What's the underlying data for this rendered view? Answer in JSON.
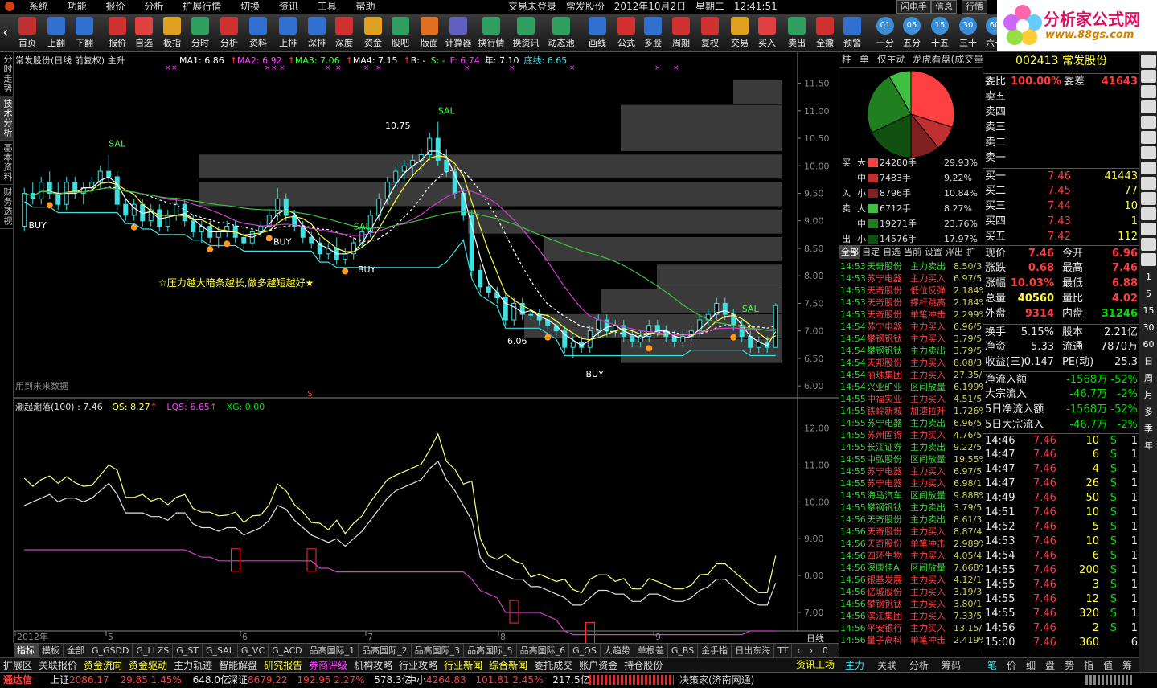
{
  "menu": [
    "系统",
    "功能",
    "报价",
    "分析",
    "扩展行情",
    "切换",
    "资讯",
    "工具",
    "帮助"
  ],
  "title": {
    "login": "交易未登录",
    "stock": "常发股份",
    "date": "2012年10月2日",
    "weekday": "星期二",
    "time": "12:41:51"
  },
  "top_buttons": [
    "闪电手",
    "信息",
    "行情"
  ],
  "toolbar": [
    "首页",
    "上翻",
    "下翻",
    "报价",
    "自选",
    "板指",
    "分时",
    "分析",
    "资料",
    "上排",
    "深排",
    "深度",
    "资金",
    "股吧",
    "版面",
    "计算器",
    "换行情",
    "换资讯",
    "动态池",
    "画线",
    "公式",
    "多股",
    "周期",
    "复权",
    "交易",
    "买入",
    "卖出",
    "全撤",
    "预警",
    "一分",
    "五分",
    "十五",
    "三十",
    "六十"
  ],
  "logo": {
    "text": "分析家公式网",
    "url": "www.88gs.com"
  },
  "left_tabs": [
    "分时走势",
    "技术分析",
    "基本资料",
    "财务透视"
  ],
  "chart": {
    "header": "常发股份(日线 前复权) 主升",
    "ma": [
      {
        "label": "MA1: 6.86",
        "color": "#ffffff"
      },
      {
        "label": "MA2: 6.92",
        "color": "#ff40ff"
      },
      {
        "label": "MA3: 7.06",
        "color": "#40ff40"
      },
      {
        "label": "MA4: 7.15",
        "color": "#ffffff"
      },
      {
        "label": "B: -",
        "color": "#ffffff"
      },
      {
        "label": "S: -",
        "color": "#40ff40"
      },
      {
        "label": "F: 6.74",
        "color": "#ff40ff"
      },
      {
        "label": "年: 7.10",
        "color": "#ffffff"
      },
      {
        "label": "底线: 6.65",
        "color": "#40e0e0"
      }
    ],
    "price_axis": [
      "11.50",
      "11.00",
      "10.50",
      "10.00",
      "9.50",
      "9.00",
      "8.50",
      "8.00",
      "7.50",
      "7.00",
      "6.50",
      "6.00"
    ],
    "slogan": "☆压力越大暗条越长,做多越短越好★",
    "future_label": "用到未来数据",
    "peak_label": "10.75",
    "low_label": "6.06",
    "sub_header": "潮起潮落(100) : 7.46",
    "qs": "QS: 8.27",
    "lqs": "LQS: 6.65",
    "xg": "XG: 0.00",
    "sub_axis": [
      "12.00",
      "11.00",
      "10.00",
      "9.00",
      "8.00",
      "7.00"
    ],
    "date_labels": [
      "2012年",
      "5",
      "6",
      "7",
      "8",
      "9"
    ],
    "period": "日线"
  },
  "signals": {
    "sal": "SAL",
    "buy": "BUY"
  },
  "mid": {
    "tabs": [
      "柱",
      "单",
      "仅主动",
      "龙虎看盘(成交量排名)"
    ],
    "flows": [
      {
        "side": "买",
        "size": "大",
        "value": "24280手",
        "pct": "29.93%",
        "color": "#ff4040"
      },
      {
        "side": "",
        "size": "中",
        "value": "7483手",
        "pct": "9.22%",
        "color": "#c03030"
      },
      {
        "side": "入",
        "size": "小",
        "value": "8796手",
        "pct": "10.84%",
        "color": "#802020"
      },
      {
        "side": "卖",
        "size": "大",
        "value": "6712手",
        "pct": "8.27%",
        "color": "#40c040"
      },
      {
        "side": "",
        "size": "中",
        "value": "19271手",
        "pct": "23.76%",
        "color": "#208020"
      },
      {
        "side": "出",
        "size": "小",
        "value": "14576手",
        "pct": "17.97%",
        "color": "#105010"
      }
    ],
    "filter_tabs": [
      "全部",
      "自定",
      "自选",
      "当前",
      "设置",
      "浮出",
      "扩"
    ],
    "radar": [
      [
        "14:53",
        "天奇股份",
        "主力卖出",
        "8.50/3"
      ],
      [
        "14:53",
        "苏宁电器",
        "主力买入",
        "6.97/5"
      ],
      [
        "14:53",
        "天奇股份",
        "低位反弹",
        "2.184%"
      ],
      [
        "14:53",
        "天奇股份",
        "撑杆跳高",
        "2.184%"
      ],
      [
        "14:53",
        "天奇股份",
        "单笔冲击",
        "2.299%"
      ],
      [
        "14:54",
        "苏宁电器",
        "主力买入",
        "6.96/5"
      ],
      [
        "14:54",
        "攀钢钒钛",
        "主力买入",
        "3.79/5"
      ],
      [
        "14:54",
        "攀钢钒钛",
        "主力卖出",
        "3.79/5"
      ],
      [
        "14:54",
        "天邦股份",
        "主力买入",
        "8.08/3"
      ],
      [
        "14:54",
        "丽珠集团",
        "主力买入",
        "27.35/"
      ],
      [
        "14:54",
        "兴业矿业",
        "区间放量",
        "6.199%"
      ],
      [
        "14:55",
        "中福实业",
        "主力买入",
        "4.51/5"
      ],
      [
        "14:55",
        "铁岭新城",
        "加速拉升",
        "1.726%"
      ],
      [
        "14:55",
        "苏宁电器",
        "主力卖出",
        "6.96/5"
      ],
      [
        "14:55",
        "苏州固锝",
        "主力买入",
        "4.76/5"
      ],
      [
        "14:55",
        "长江证券",
        "主力卖出",
        "9.22/5"
      ],
      [
        "14:55",
        "中弘股份",
        "区间放量",
        "19.55%"
      ],
      [
        "14:55",
        "苏宁电器",
        "主力买入",
        "6.97/5"
      ],
      [
        "14:55",
        "苏宁电器",
        "主力买入",
        "6.98/1"
      ],
      [
        "14:55",
        "海马汽车",
        "区间放量",
        "9.888%"
      ],
      [
        "14:55",
        "攀钢钒钛",
        "主力卖出",
        "3.79/5"
      ],
      [
        "14:56",
        "天奇股份",
        "主力卖出",
        "8.61/3"
      ],
      [
        "14:56",
        "天奇股份",
        "主力买入",
        "8.87/4"
      ],
      [
        "14:56",
        "天奇股份",
        "单笔冲击",
        "2.989%"
      ],
      [
        "14:56",
        "四环生物",
        "主力买入",
        "4.05/4"
      ],
      [
        "14:56",
        "深康佳A",
        "区间放量",
        "7.668%"
      ],
      [
        "14:56",
        "银基发展",
        "主力买入",
        "4.12/1"
      ],
      [
        "14:56",
        "亿城股份",
        "主力买入",
        "3.19/3"
      ],
      [
        "14:56",
        "攀钢钒钛",
        "主力买入",
        "3.80/1"
      ],
      [
        "14:56",
        "滨江集团",
        "主力买入",
        "7.33/5"
      ],
      [
        "14:56",
        "平安银行",
        "主力买入",
        "13.15/"
      ],
      [
        "14:56",
        "量子高科",
        "单笔冲击",
        "2.419%"
      ]
    ]
  },
  "quote": {
    "code": "002413",
    "name": "常发股份",
    "wb_label": "委比",
    "wb": "100.00%",
    "wc_label": "委差",
    "wc": "41643",
    "asks": [
      {
        "l": "卖五",
        "p": "",
        "v": ""
      },
      {
        "l": "卖四",
        "p": "",
        "v": ""
      },
      {
        "l": "卖三",
        "p": "",
        "v": ""
      },
      {
        "l": "卖二",
        "p": "",
        "v": ""
      },
      {
        "l": "卖一",
        "p": "",
        "v": ""
      }
    ],
    "bids": [
      {
        "l": "买一",
        "p": "7.46",
        "v": "41443"
      },
      {
        "l": "买二",
        "p": "7.45",
        "v": "77"
      },
      {
        "l": "买三",
        "p": "7.44",
        "v": "10"
      },
      {
        "l": "买四",
        "p": "7.43",
        "v": "1"
      },
      {
        "l": "买五",
        "p": "7.42",
        "v": "112"
      }
    ],
    "stats": [
      {
        "l1": "现价",
        "v1": "7.46",
        "c1": "red",
        "l2": "今开",
        "v2": "6.96",
        "c2": "red"
      },
      {
        "l1": "涨跌",
        "v1": "0.68",
        "c1": "red",
        "l2": "最高",
        "v2": "7.46",
        "c2": "red"
      },
      {
        "l1": "涨幅",
        "v1": "10.03%",
        "c1": "red",
        "l2": "最低",
        "v2": "6.88",
        "c2": "red"
      },
      {
        "l1": "总量",
        "v1": "40560",
        "c1": "yellow",
        "l2": "量比",
        "v2": "4.02",
        "c2": "red"
      },
      {
        "l1": "外盘",
        "v1": "9314",
        "c1": "red",
        "l2": "内盘",
        "v2": "31246",
        "c2": "green"
      }
    ],
    "stats2": [
      {
        "l1": "换手",
        "v1": "5.15%",
        "l2": "股本",
        "v2": "2.21亿"
      },
      {
        "l1": "净资",
        "v1": "5.33",
        "l2": "流通",
        "v2": "7870万"
      },
      {
        "l1": "收益(三)",
        "v1": "0.147",
        "l2": "PE(动)",
        "v2": "25.3"
      }
    ],
    "flow": [
      {
        "l": "净流入额",
        "v": "-1568万",
        "p": "-52%"
      },
      {
        "l": "大宗流入",
        "v": "-46.7万",
        "p": "-2%"
      },
      {
        "l": "5日净流入额",
        "v": "-1568万",
        "p": "-52%"
      },
      {
        "l": "5日大宗流入",
        "v": "-46.7万",
        "p": "-2%"
      }
    ],
    "ticks": [
      [
        "14:46",
        "7.46",
        "10",
        "S",
        "1"
      ],
      [
        "14:47",
        "7.46",
        "6",
        "S",
        "1"
      ],
      [
        "14:47",
        "7.46",
        "4",
        "S",
        "1"
      ],
      [
        "14:47",
        "7.46",
        "26",
        "S",
        "1"
      ],
      [
        "14:49",
        "7.46",
        "50",
        "S",
        "1"
      ],
      [
        "14:51",
        "7.46",
        "10",
        "S",
        "1"
      ],
      [
        "14:52",
        "7.46",
        "5",
        "S",
        "1"
      ],
      [
        "14:53",
        "7.46",
        "10",
        "S",
        "1"
      ],
      [
        "14:54",
        "7.46",
        "6",
        "S",
        "1"
      ],
      [
        "14:55",
        "7.46",
        "200",
        "S",
        "1"
      ],
      [
        "14:55",
        "7.46",
        "3",
        "S",
        "1"
      ],
      [
        "14:55",
        "7.46",
        "12",
        "S",
        "1"
      ],
      [
        "14:55",
        "7.46",
        "320",
        "S",
        "1"
      ],
      [
        "14:56",
        "7.46",
        "2",
        "S",
        "1"
      ],
      [
        "15:00",
        "7.46",
        "360",
        "",
        "6"
      ]
    ],
    "bottom_tabs": [
      "笔",
      "价",
      "细",
      "盘",
      "势",
      "指",
      "值",
      "筹"
    ]
  },
  "side_icons": [
    "1",
    "5",
    "15",
    "30",
    "60",
    "日",
    "周",
    "月",
    "多",
    "季",
    "年"
  ],
  "bottom_tabs": [
    "指标",
    "模板",
    "全部",
    "G_GSDD",
    "G_LLZS",
    "G_ST",
    "G_SAL",
    "G_VC",
    "G_ACD",
    "品高国际_1",
    "品高国际_2",
    "品高国际_3",
    "品高国际_5",
    "品高国际_6",
    "G_QS",
    "大趋势",
    "单根差",
    "G_BS",
    "金手指",
    "日出东海",
    "TT"
  ],
  "toolbar2": [
    {
      "t": "扩展区",
      "c": "#ddd"
    },
    {
      "t": "关联报价",
      "c": "#ddd"
    },
    {
      "t": "资金流向",
      "c": "#ffff40"
    },
    {
      "t": "资金驱动",
      "c": "#ffff40"
    },
    {
      "t": "主力轨迹",
      "c": "#ddd"
    },
    {
      "t": "智能解盘",
      "c": "#ddd"
    },
    {
      "t": "研究报告",
      "c": "#ffff40"
    },
    {
      "t": "券商评级",
      "c": "#ff40ff"
    },
    {
      "t": "机构攻略",
      "c": "#ddd"
    },
    {
      "t": "行业攻略",
      "c": "#ddd"
    },
    {
      "t": "行业新闻",
      "c": "#ffff40"
    },
    {
      "t": "综合新闻",
      "c": "#ffff40"
    },
    {
      "t": "委托成交",
      "c": "#ddd"
    },
    {
      "t": "账户资金",
      "c": "#ddd"
    },
    {
      "t": "持仓股份",
      "c": "#ddd"
    }
  ],
  "info_bar": {
    "label": "资讯工场",
    "tabs": [
      "主力",
      "关联",
      "分析",
      "筹码"
    ]
  },
  "status": {
    "brand": "通达信",
    "sh": {
      "name": "上证",
      "val": "2086.17",
      "chg": "29.85",
      "pct": "1.45%",
      "amt": "648.0亿"
    },
    "sz": {
      "name": "深证",
      "val": "8679.22",
      "chg": "192.95",
      "pct": "2.27%",
      "amt": "578.3亿"
    },
    "zx": {
      "name": "中小",
      "val": "4264.83",
      "chg": "101.81",
      "pct": "2.45%",
      "amt": "217.5亿"
    },
    "right": "决策家(济南网通)"
  },
  "series": {
    "price": {
      "min": 5.9,
      "max": 11.8
    },
    "candles": [
      [
        8.9,
        9.6,
        8.8,
        9.5
      ],
      [
        9.5,
        9.7,
        9.3,
        9.4
      ],
      [
        9.4,
        9.8,
        9.3,
        9.7
      ],
      [
        9.7,
        9.9,
        9.4,
        9.5
      ],
      [
        9.5,
        9.7,
        9.2,
        9.3
      ],
      [
        9.3,
        9.8,
        9.2,
        9.7
      ],
      [
        9.7,
        9.8,
        9.4,
        9.5
      ],
      [
        9.5,
        9.7,
        9.3,
        9.6
      ],
      [
        9.6,
        9.8,
        9.5,
        9.7
      ],
      [
        9.7,
        10.0,
        9.6,
        9.9
      ],
      [
        9.9,
        10.2,
        9.7,
        9.8
      ],
      [
        9.8,
        9.9,
        9.2,
        9.3
      ],
      [
        9.3,
        9.4,
        9.0,
        9.1
      ],
      [
        9.1,
        9.4,
        9.0,
        9.3
      ],
      [
        9.3,
        9.4,
        8.9,
        9.0
      ],
      [
        9.0,
        9.3,
        8.9,
        9.2
      ],
      [
        9.2,
        9.3,
        8.8,
        8.9
      ],
      [
        8.9,
        9.2,
        8.8,
        9.1
      ],
      [
        9.1,
        9.4,
        9.0,
        9.3
      ],
      [
        9.3,
        9.4,
        8.9,
        9.0
      ],
      [
        9.0,
        9.1,
        8.7,
        8.8
      ],
      [
        8.8,
        9.0,
        8.6,
        8.9
      ],
      [
        8.9,
        9.0,
        8.6,
        8.7
      ],
      [
        8.7,
        8.9,
        8.5,
        8.8
      ],
      [
        8.8,
        9.0,
        8.7,
        8.9
      ],
      [
        8.9,
        9.0,
        8.6,
        8.7
      ],
      [
        8.7,
        8.8,
        8.5,
        8.6
      ],
      [
        8.6,
        8.9,
        8.5,
        8.8
      ],
      [
        8.8,
        9.0,
        8.7,
        8.9
      ],
      [
        8.9,
        9.2,
        8.8,
        9.1
      ],
      [
        9.1,
        9.6,
        9.0,
        9.4
      ],
      [
        9.4,
        9.5,
        9.0,
        9.1
      ],
      [
        9.1,
        9.2,
        8.8,
        8.9
      ],
      [
        8.9,
        9.0,
        8.6,
        8.7
      ],
      [
        8.7,
        8.8,
        8.5,
        8.6
      ],
      [
        8.6,
        8.7,
        8.3,
        8.4
      ],
      [
        8.4,
        8.6,
        8.3,
        8.5
      ],
      [
        8.5,
        8.7,
        8.2,
        8.3
      ],
      [
        8.3,
        8.5,
        8.2,
        8.4
      ],
      [
        8.4,
        8.7,
        8.3,
        8.6
      ],
      [
        8.6,
        8.9,
        8.5,
        8.8
      ],
      [
        8.8,
        9.2,
        8.7,
        9.1
      ],
      [
        9.1,
        9.5,
        9.0,
        9.4
      ],
      [
        9.4,
        9.8,
        9.3,
        9.7
      ],
      [
        9.7,
        10.0,
        9.6,
        9.9
      ],
      [
        9.9,
        10.1,
        9.7,
        10.0
      ],
      [
        10.0,
        10.2,
        9.8,
        10.1
      ],
      [
        10.1,
        10.3,
        9.9,
        10.2
      ],
      [
        10.2,
        10.6,
        10.1,
        10.5
      ],
      [
        10.5,
        10.8,
        10.0,
        10.1
      ],
      [
        10.1,
        10.3,
        9.8,
        9.9
      ],
      [
        9.9,
        10.0,
        9.4,
        9.5
      ],
      [
        9.5,
        9.6,
        9.0,
        9.1
      ],
      [
        9.1,
        9.2,
        8.0,
        8.1
      ],
      [
        8.1,
        8.2,
        7.7,
        7.8
      ],
      [
        7.8,
        7.9,
        7.6,
        7.7
      ],
      [
        7.7,
        7.8,
        7.5,
        7.6
      ],
      [
        7.6,
        7.7,
        7.1,
        7.2
      ],
      [
        7.2,
        7.6,
        7.1,
        7.5
      ],
      [
        7.5,
        7.6,
        7.2,
        7.3
      ],
      [
        7.3,
        7.4,
        7.2,
        7.3
      ],
      [
        7.3,
        7.4,
        7.1,
        7.2
      ],
      [
        7.2,
        7.3,
        7.0,
        7.1
      ],
      [
        7.1,
        7.2,
        6.9,
        7.0
      ],
      [
        7.0,
        7.1,
        6.6,
        6.7
      ],
      [
        6.7,
        6.9,
        6.5,
        6.8
      ],
      [
        6.8,
        6.9,
        6.6,
        6.7
      ],
      [
        6.7,
        7.1,
        6.6,
        7.0
      ],
      [
        7.0,
        7.3,
        6.9,
        7.2
      ],
      [
        7.2,
        7.3,
        6.9,
        7.0
      ],
      [
        7.0,
        7.2,
        6.9,
        7.1
      ],
      [
        7.1,
        7.2,
        6.8,
        6.9
      ],
      [
        6.9,
        7.0,
        6.7,
        6.8
      ],
      [
        6.8,
        7.0,
        6.7,
        6.9
      ],
      [
        6.9,
        7.2,
        6.8,
        7.1
      ],
      [
        7.1,
        7.2,
        6.9,
        7.0
      ],
      [
        7.0,
        7.1,
        6.8,
        6.9
      ],
      [
        6.9,
        7.0,
        6.7,
        6.8
      ],
      [
        6.8,
        7.0,
        6.7,
        6.9
      ],
      [
        6.9,
        7.1,
        6.8,
        7.0
      ],
      [
        7.0,
        7.3,
        6.9,
        7.2
      ],
      [
        7.2,
        7.4,
        7.1,
        7.3
      ],
      [
        7.3,
        7.6,
        7.2,
        7.5
      ],
      [
        7.5,
        7.6,
        7.2,
        7.3
      ],
      [
        7.3,
        7.4,
        7.0,
        7.1
      ],
      [
        7.1,
        7.2,
        6.8,
        6.9
      ],
      [
        6.9,
        7.0,
        6.6,
        6.7
      ],
      [
        6.7,
        6.9,
        6.6,
        6.8
      ],
      [
        6.8,
        6.9,
        6.6,
        6.7
      ],
      [
        6.7,
        7.5,
        6.7,
        7.46
      ]
    ]
  }
}
